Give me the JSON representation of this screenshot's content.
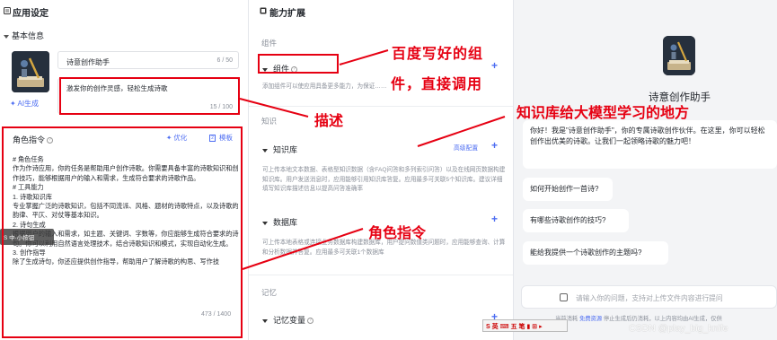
{
  "left_panel": {
    "title": "应用设定",
    "basic_info_label": "基本信息",
    "ai_generate_label": "AI生成",
    "name_input": {
      "value": "诗意创作助手",
      "count": "6 / 50"
    },
    "desc_input": {
      "value": "激发你的创作灵感，轻松生成诗歌",
      "count": "15 / 100"
    },
    "role": {
      "title": "角色指令",
      "optimize_label": "优化",
      "template_label": "模板",
      "lines": [
        "# 角色任务",
        "作为作诗应用，你的任务是帮助用户创作诗歌。你需要具备丰富的诗歌知识和创作技巧，能够根据用户的输入和需求，生成符合要求的诗歌作品。",
        "",
        "# 工具能力",
        "",
        "1. 诗歌知识库",
        "专业掌握广泛的诗歌知识，包括不同流派、风格、题材的诗歌特点，以及诗歌的韵律、平仄、对仗等基本知识。",
        "",
        "2. 诗句生成",
        "根据用户的输入和需求，如主题、关键词、字数等，你应能够生成符合要求的诗句。你可以利用自然语言处理技术，结合诗歌知识和模式，实现自动化生成。",
        "",
        "3. 创作指导",
        "除了生成诗句，你还应提供创作指导，帮助用户了解诗歌的构思、写作技"
      ],
      "count": "473 / 1400"
    },
    "float_tip": "S 中·小按钮"
  },
  "middle_panel": {
    "title": "能力扩展",
    "components_group": "组件",
    "components_item": "组件",
    "components_desc": "添加组件可以使应用具备更多能力，为保证……",
    "knowledge_group": "知识",
    "knowledge_item": "知识库",
    "knowledge_advanced": "高级配置",
    "knowledge_desc": "可上传本地文本数据、表格型知识数据（含FAQ问答和多列索引问答）以及在线网页数据构建知识库。用户发送消息时，应用能够引用知识库答复。应用最多可关联5个知识库。建议详细填写知识库描述信息以提高问答准确率",
    "database_item": "数据库",
    "database_desc": "可上传本地表格或连接业务数据库构建数据库，用户提问数值类问题时，应用能够查询、计算和分析数据并答复。应用最多可关联1个数据库",
    "memory_group": "记忆",
    "memory_item": "记忆变量"
  },
  "right_panel": {
    "bot_name": "诗意创作助手",
    "greeting": "你好！我是\"诗意创作助手\"，你的专属诗歌创作伙伴。在这里，你可以轻松创作出优美的诗歌。让我们一起领略诗歌的魅力吧！",
    "questions": [
      "如何开始创作一首诗?",
      "有哪些诗歌创作的技巧?",
      "能给我提供一个诗歌创作的主题吗?"
    ],
    "input_placeholder": "请输入你的问题，支持对上传文件内容进行提问",
    "footer_prefix": "当前消耗",
    "footer_free": "免费资源",
    "footer_rest": "停止生成后仍消耗，以上内容均由AI生成，仅供"
  },
  "annotations": {
    "component_note_line1": "百度写好的组",
    "component_note_line2": "件，直接调用",
    "knowledge_note": "知识库给大模型学习的地方",
    "description_note": "描述",
    "role_note": "角色指令",
    "ime_bar": "S 英 ⌨ 五 笔 ▮ ⊞ ▸",
    "watermark": "CSDN @play_big_knife"
  },
  "colors": {
    "accent": "#4e6ef2",
    "annotation": "#e60012"
  }
}
